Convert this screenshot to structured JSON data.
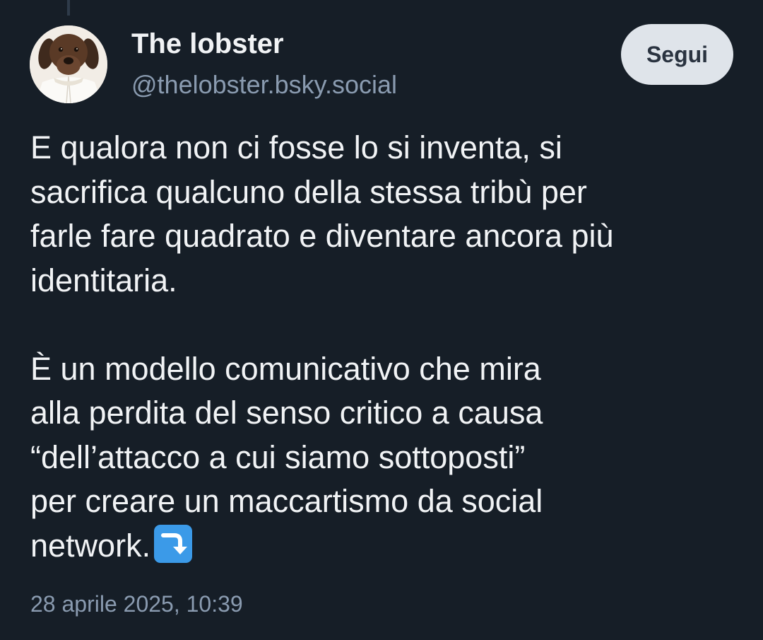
{
  "post": {
    "author": {
      "display_name": "The lobster",
      "handle": "@thelobster.bsky.social"
    },
    "follow_label": "Segui",
    "body": {
      "paragraph_1": [
        "E qualora non ci fosse lo si inventa, si",
        "sacrifica qualcuno della stessa tribù per",
        "farle fare quadrato e diventare ancora più",
        "identitaria."
      ],
      "paragraph_2": [
        "È un modello comunicativo che mira",
        "alla perdita del senso critico a causa",
        "“dell’attacco a cui siamo sottoposti”",
        "per creare un maccartismo da social",
        "network."
      ],
      "trailing_emoji": "right-arrow-curving-down-icon"
    },
    "timestamp": "28 aprile 2025, 10:39"
  },
  "colors": {
    "background": "#161e27",
    "text_primary": "#f1f3f5",
    "text_secondary": "#8a9bb0",
    "follow_bg": "#dfe4ea",
    "follow_text": "#2a3340",
    "emoji_blue": "#3b9ae8"
  }
}
